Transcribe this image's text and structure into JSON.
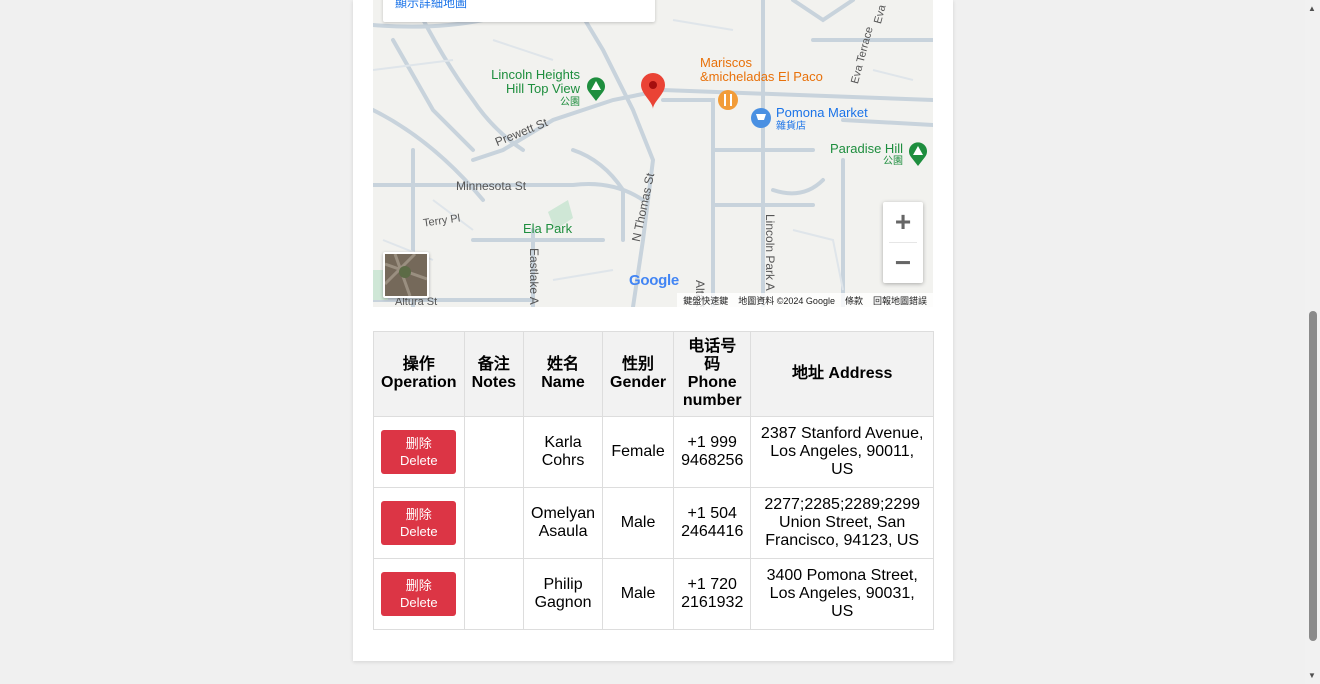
{
  "map": {
    "detail_link": "顯示詳細地圖",
    "google_logo": "Google",
    "attribution": [
      "鍵盤快速鍵",
      "地圖資料 ©2024 Google",
      "條款",
      "回報地圖錯誤"
    ],
    "labels": {
      "lincoln_heights": "Lincoln Heights",
      "hill_top_view": "Hill Top View",
      "park1": "公園",
      "mariscos": "Mariscos",
      "micheladas": "&micheladas El Paco",
      "pomona_market": "Pomona Market",
      "grocery": "雜貨店",
      "paradise_hill": "Paradise Hill",
      "park2": "公園",
      "prewett": "Prewett St",
      "minnesota": "Minnesota St",
      "terry": "Terry Pl",
      "ela_park": "Ela Park",
      "n_thomas": "N Thomas St",
      "alta": "Alta St",
      "lincoln_park": "Lincoln Park A",
      "eastlake": "Eastlake A",
      "altura": "Altura St",
      "eva_terrace": "Eva Terrace",
      "eva": "Eva"
    },
    "zoom_in": "+",
    "zoom_out": "−"
  },
  "table": {
    "headers": {
      "operation_cn": "操作",
      "operation_en": "Operation",
      "notes_cn": "备注",
      "notes_en": "Notes",
      "name_cn": "姓名",
      "name_en": "Name",
      "gender_cn": "性别",
      "gender_en": "Gender",
      "phone_cn": "电话号码",
      "phone_en": "Phone number",
      "address": "地址 Address"
    },
    "delete_cn": "删除",
    "delete_en": "Delete",
    "rows": [
      {
        "notes": "",
        "name": "Karla Cohrs",
        "gender": "Female",
        "phone": "+1 999 9468256",
        "address": "2387 Stanford Avenue, Los Angeles, 90011, US"
      },
      {
        "notes": "",
        "name": "Omelyan Asaula",
        "gender": "Male",
        "phone": "+1 504 2464416",
        "address": "2277;2285;2289;2299 Union Street, San Francisco, 94123, US"
      },
      {
        "notes": "",
        "name": "Philip Gagnon",
        "gender": "Male",
        "phone": "+1 720 2161932",
        "address": "3400 Pomona Street, Los Angeles, 90031, US"
      }
    ]
  },
  "colors": {
    "delete": "#dc3545",
    "link": "#1a73e8",
    "park": "#1e8e3e",
    "restaurant": "#e8710a",
    "shop": "#1a73e8",
    "pin": "#ea4335"
  }
}
